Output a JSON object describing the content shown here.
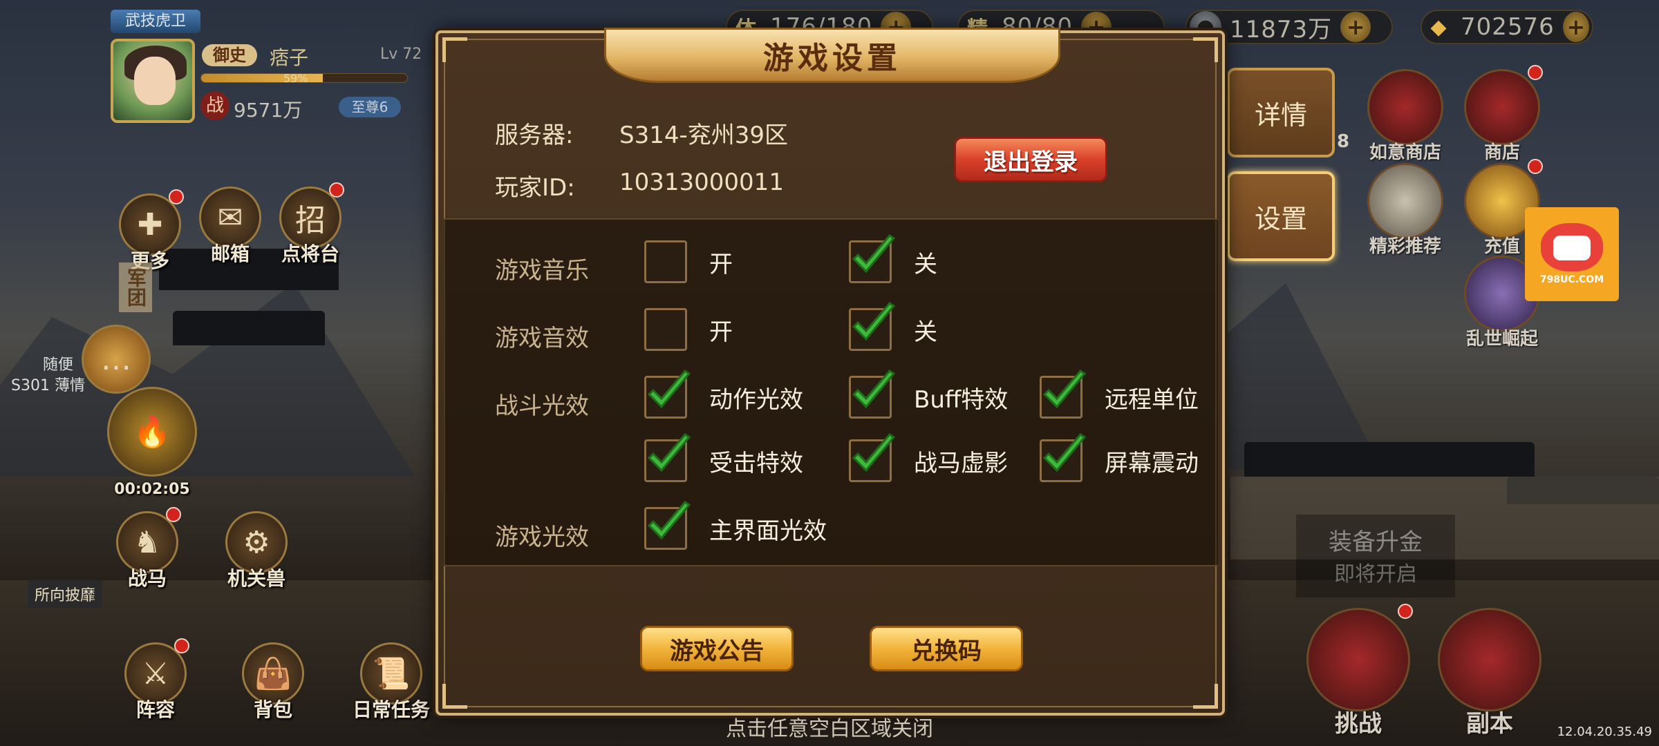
{
  "hud": {
    "stamina_glyph": "体",
    "stamina": "176/180",
    "energy_glyph": "精",
    "energy": "80/80",
    "silver": "11873万",
    "gold": "702576"
  },
  "player": {
    "title": "武技虎卫",
    "rank": "御史",
    "name": "痞子",
    "level": "Lv 72",
    "exp_percent": 59,
    "exp_text": "59%",
    "power_glyph": "战",
    "power": "9571万",
    "vip": "至尊6"
  },
  "left_menu": {
    "more": "更多",
    "mail": "邮箱",
    "recruit": "点将台",
    "legion": "军团",
    "warhorse": "战马",
    "mech_beast": "机关兽",
    "lineup": "阵容",
    "bag": "背包",
    "daily": "日常任务",
    "timer": "00:02:05",
    "chat_line": "S301 薄情",
    "follow": "随便",
    "plaque": "所向披靡"
  },
  "right_menu": {
    "ruyi_shop": "如意商店",
    "shop": "商店",
    "recommend": "精彩推荐",
    "recharge": "充值",
    "chaos": "乱世崛起",
    "challenge": "挑战",
    "dungeon": "副本",
    "equip_upgrade": "装备升金",
    "coming_soon": "即将开启",
    "num_badge": "8"
  },
  "side_tabs": {
    "details": "详情",
    "settings": "设置"
  },
  "modal": {
    "title": "游戏设置",
    "server_label": "服务器:",
    "server_value": "S314-兖州39区",
    "player_id_label": "玩家ID:",
    "player_id_value": "10313000011",
    "logout": "退出登录",
    "rows": {
      "music": {
        "label": "游戏音乐",
        "on": "开",
        "off": "关",
        "on_checked": false,
        "off_checked": true
      },
      "sound": {
        "label": "游戏音效",
        "on": "开",
        "off": "关",
        "on_checked": false,
        "off_checked": true
      },
      "battle": {
        "label": "战斗光效",
        "opts": [
          "动作光效",
          "Buff特效",
          "远程单位",
          "受击特效",
          "战马虚影",
          "屏幕震动"
        ],
        "checked": [
          true,
          true,
          true,
          true,
          true,
          true
        ]
      },
      "ui_fx": {
        "label": "游戏光效",
        "opt": "主界面光效",
        "checked": true
      }
    },
    "announcement": "游戏公告",
    "redeem": "兑换码"
  },
  "logo": {
    "url": "798UC.COM"
  },
  "hint": "点击任意空白区域关闭",
  "clock": "12.04.20.35.49",
  "colors": {
    "accent_gold": "#e2b565",
    "logout_red": "#d9412a",
    "check_green": "#3db83a"
  }
}
